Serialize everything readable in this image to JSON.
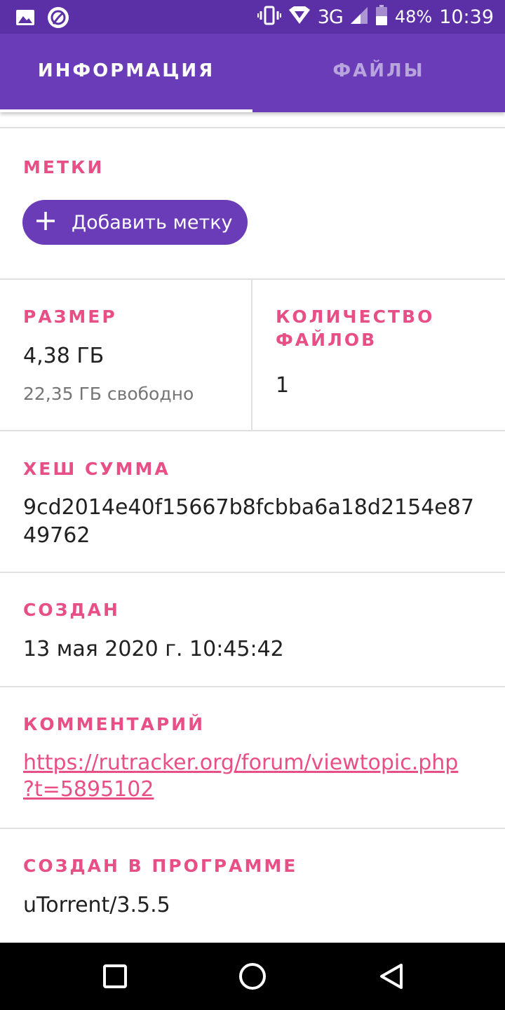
{
  "status_bar": {
    "network": "3G",
    "battery": "48%",
    "time": "10:39",
    "icons": [
      "image-icon",
      "sync-app-icon",
      "vibrate-icon",
      "wifi-icon",
      "signal-icon",
      "battery-icon"
    ]
  },
  "tabs": [
    {
      "label": "ИНФОРМАЦИЯ",
      "active": true
    },
    {
      "label": "ФАЙЛЫ",
      "active": false
    }
  ],
  "tags": {
    "title": "МЕТКИ",
    "add_button": "Добавить метку",
    "icon": "plus-icon"
  },
  "size": {
    "title": "РАЗМЕР",
    "value": "4,38 ГБ",
    "free": "22,35 ГБ свободно"
  },
  "file_count": {
    "title_line1": "КОЛИЧЕСТВО",
    "title_line2": "ФАЙЛОВ",
    "value": "1"
  },
  "hash": {
    "title": "ХЕШ СУММА",
    "line1": "9cd2014e40f15667b8fcbba6a18d2154e87",
    "line2": "49762"
  },
  "created": {
    "title": "СОЗДАН",
    "value": "13 мая 2020 г. 10:45:42"
  },
  "comment": {
    "title": "КОММЕНТАРИЙ",
    "link_line1": "https://rutracker.org/forum/viewtopic.php",
    "link_line2": "?t=5895102"
  },
  "created_by": {
    "title": "СОЗДАН В ПРОГРАММЕ",
    "value": "uTorrent/3.5.5"
  },
  "colors": {
    "status_bar": "#5b2fa6",
    "primary": "#6a3cb8",
    "accent": "#e94f87",
    "text": "#212121",
    "secondary_text": "#757575",
    "divider": "#e0e0e0"
  },
  "nav": [
    "recent-apps-square-icon",
    "home-circle-icon",
    "back-triangle-icon"
  ]
}
